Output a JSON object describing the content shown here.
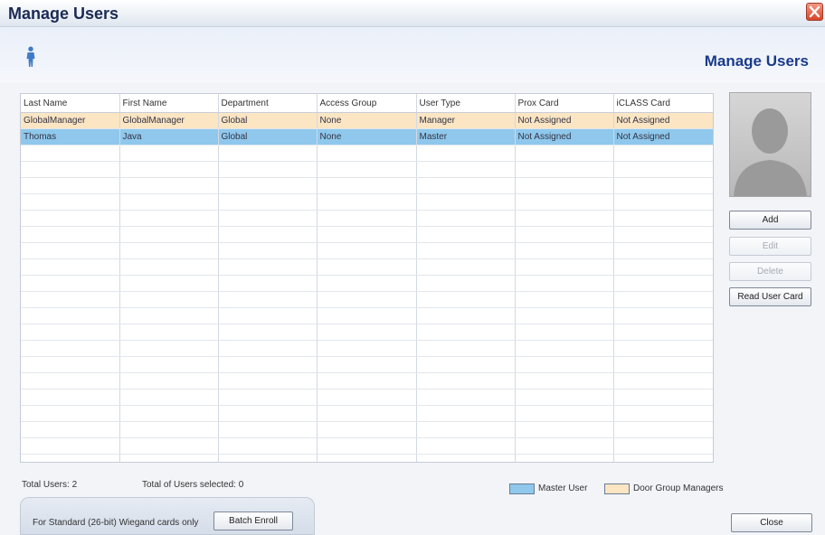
{
  "window": {
    "title": "Manage Users"
  },
  "header": {
    "title": "Manage Users"
  },
  "table": {
    "columns": [
      "Last Name",
      "First Name",
      "Department",
      "Access Group",
      "User Type",
      "Prox Card",
      "iCLASS Card"
    ],
    "rows": [
      {
        "kind": "manager",
        "cells": [
          "GlobalManager",
          "GlobalManager",
          "Global",
          "None",
          "Manager",
          "Not Assigned",
          "Not Assigned"
        ]
      },
      {
        "kind": "master",
        "cells": [
          "Thomas",
          "Java",
          "Global",
          "None",
          "Master",
          "Not Assigned",
          "Not Assigned"
        ]
      }
    ],
    "empty_rows": 20
  },
  "side_buttons": {
    "add": "Add",
    "edit": "Edit",
    "delete": "Delete",
    "read_card": "Read User Card"
  },
  "footer": {
    "total_users": "Total Users: 2",
    "total_selected": "Total of Users selected: 0",
    "legend": [
      {
        "label": "Master User",
        "color": "#8fc8ec"
      },
      {
        "label": "Door Group Managers",
        "color": "#fbe5c3"
      }
    ],
    "batch_note": "For Standard (26-bit) Wiegand cards only",
    "batch_button": "Batch Enroll",
    "close_button": "Close"
  },
  "icons": {
    "title_close": "close-icon",
    "header": "person-icon",
    "photo": "user-silhouette-icon"
  }
}
